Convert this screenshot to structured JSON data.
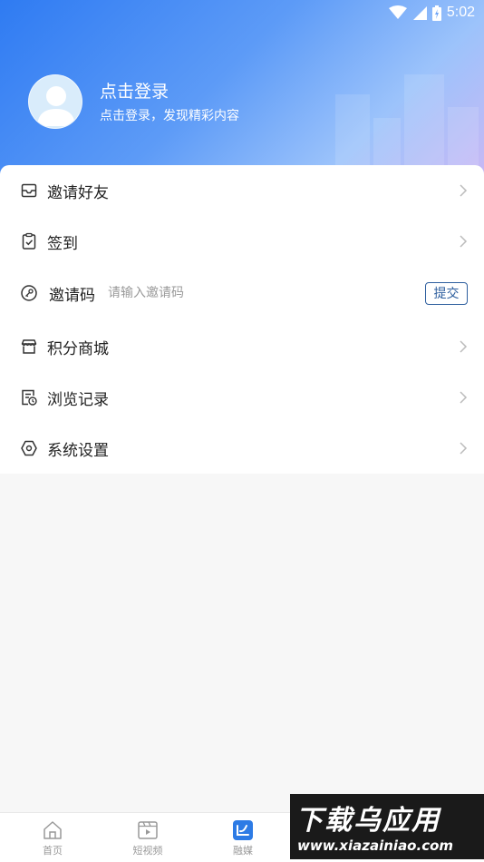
{
  "status_bar": {
    "time": "5:02"
  },
  "profile": {
    "title": "点击登录",
    "subtitle": "点击登录，发现精彩内容"
  },
  "menu": {
    "invite_friends": "邀请好友",
    "sign_in": "签到",
    "invite_code": {
      "label": "邀请码",
      "placeholder": "请输入邀请码",
      "submit_label": "提交"
    },
    "points_mall": "积分商城",
    "history": "浏览记录",
    "settings": "系统设置"
  },
  "tabs": [
    {
      "label": "首页",
      "icon": "home-icon"
    },
    {
      "label": "短视频",
      "icon": "video-icon"
    },
    {
      "label": "融媒",
      "icon": "media-logo-icon"
    }
  ],
  "watermark": {
    "title": "下载乌应用",
    "url": "www.xiazainiao.com"
  },
  "colors": {
    "header_gradient_start": "#2f7bf2",
    "header_gradient_end": "#c9b8f5",
    "submit_border": "#2d5e9e",
    "active_tab": "#2d7be5"
  }
}
